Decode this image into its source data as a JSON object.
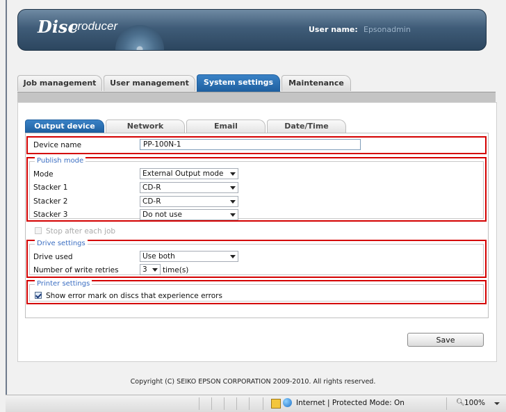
{
  "header": {
    "logo_bold": "Disc",
    "logo_light": "producer",
    "user_label": "User name:",
    "user_value": "Epsonadmin"
  },
  "main_tabs": [
    {
      "label": "Job management"
    },
    {
      "label": "User management"
    },
    {
      "label": "System settings",
      "active": true
    },
    {
      "label": "Maintenance"
    }
  ],
  "sub_tabs": [
    {
      "label": "Output device",
      "active": true
    },
    {
      "label": "Network"
    },
    {
      "label": "Email"
    },
    {
      "label": "Date/Time"
    }
  ],
  "device": {
    "label": "Device name",
    "value": "PP-100N-1"
  },
  "publish_mode": {
    "legend": "Publish mode",
    "mode_label": "Mode",
    "mode_value": "External Output mode",
    "stacker1_label": "Stacker 1",
    "stacker1_value": "CD-R",
    "stacker2_label": "Stacker 2",
    "stacker2_value": "CD-R",
    "stacker3_label": "Stacker 3",
    "stacker3_value": "Do not use"
  },
  "stop_after_job": {
    "label": "Stop after each job",
    "checked": false,
    "disabled": true
  },
  "drive_settings": {
    "legend": "Drive settings",
    "drive_label": "Drive used",
    "drive_value": "Use both",
    "retries_label": "Number of write retries",
    "retries_value": "3",
    "retries_unit": "time(s)"
  },
  "printer_settings": {
    "legend": "Printer settings",
    "error_mark_label": "Show error mark on discs that experience errors",
    "error_mark_checked": true
  },
  "actions": {
    "save_label": "Save"
  },
  "footer": {
    "copyright": "Copyright (C) SEIKO EPSON CORPORATION 2009-2010. All rights reserved."
  },
  "statusbar": {
    "zone_text": "Internet | Protected Mode: On",
    "zoom": "100%"
  },
  "colors": {
    "accent_tab": "#1e5f9f",
    "highlight_border": "#d40000",
    "legend_text": "#3b6ec2",
    "banner": "#3f5c78"
  }
}
